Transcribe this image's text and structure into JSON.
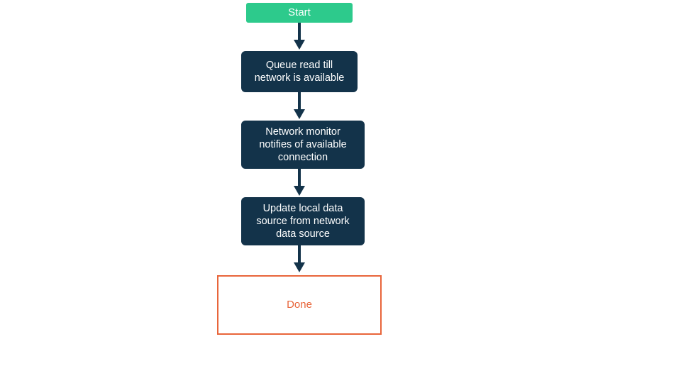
{
  "flow": {
    "start": {
      "label": "Start"
    },
    "steps": [
      {
        "label": "Queue read till network is available"
      },
      {
        "label": "Network monitor notifies of available connection"
      },
      {
        "label": "Update local data source from network data source"
      }
    ],
    "done": {
      "label": "Done"
    }
  },
  "colors": {
    "start_bg": "#2dca8c",
    "step_bg": "#13334a",
    "done_border": "#e8653a",
    "arrow": "#13334a"
  }
}
